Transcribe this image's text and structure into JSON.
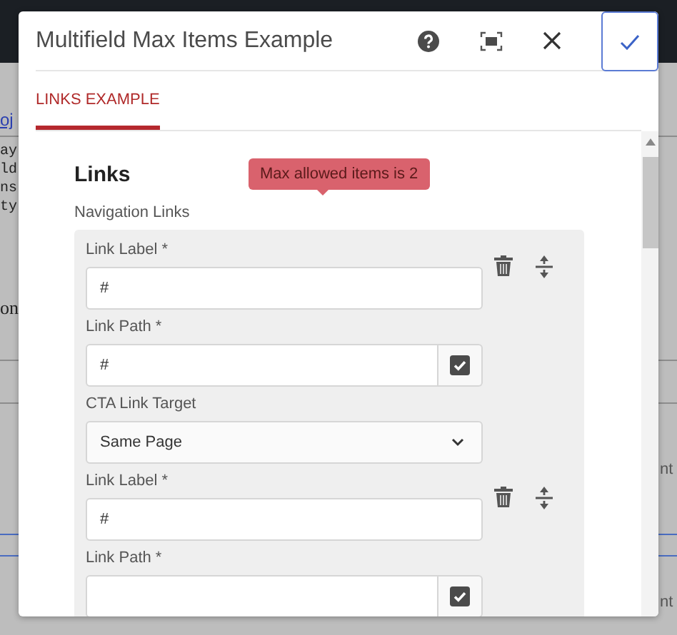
{
  "background": {
    "link": "oj",
    "code_lines": [
      "ay",
      "ld",
      "ns",
      "ty"
    ],
    "left_label": "on",
    "right_labels": [
      "nt",
      "nt"
    ]
  },
  "dialog": {
    "title": "Multifield Max Items Example",
    "tabs": [
      {
        "label": "LINKS EXAMPLE",
        "selected": true
      }
    ],
    "section_title": "Links",
    "multifield": {
      "label": "Navigation Links",
      "tooltip": "Max allowed items is 2",
      "items": [
        {
          "fields": [
            {
              "kind": "text",
              "label": "Link Label *",
              "value": "#"
            },
            {
              "kind": "path",
              "label": "Link Path *",
              "value": "#"
            },
            {
              "kind": "select",
              "label": "CTA Link Target",
              "value": "Same Page"
            }
          ]
        },
        {
          "fields": [
            {
              "kind": "text",
              "label": "Link Label *",
              "value": "#"
            },
            {
              "kind": "path",
              "label": "Link Path *"
            }
          ]
        }
      ]
    }
  }
}
